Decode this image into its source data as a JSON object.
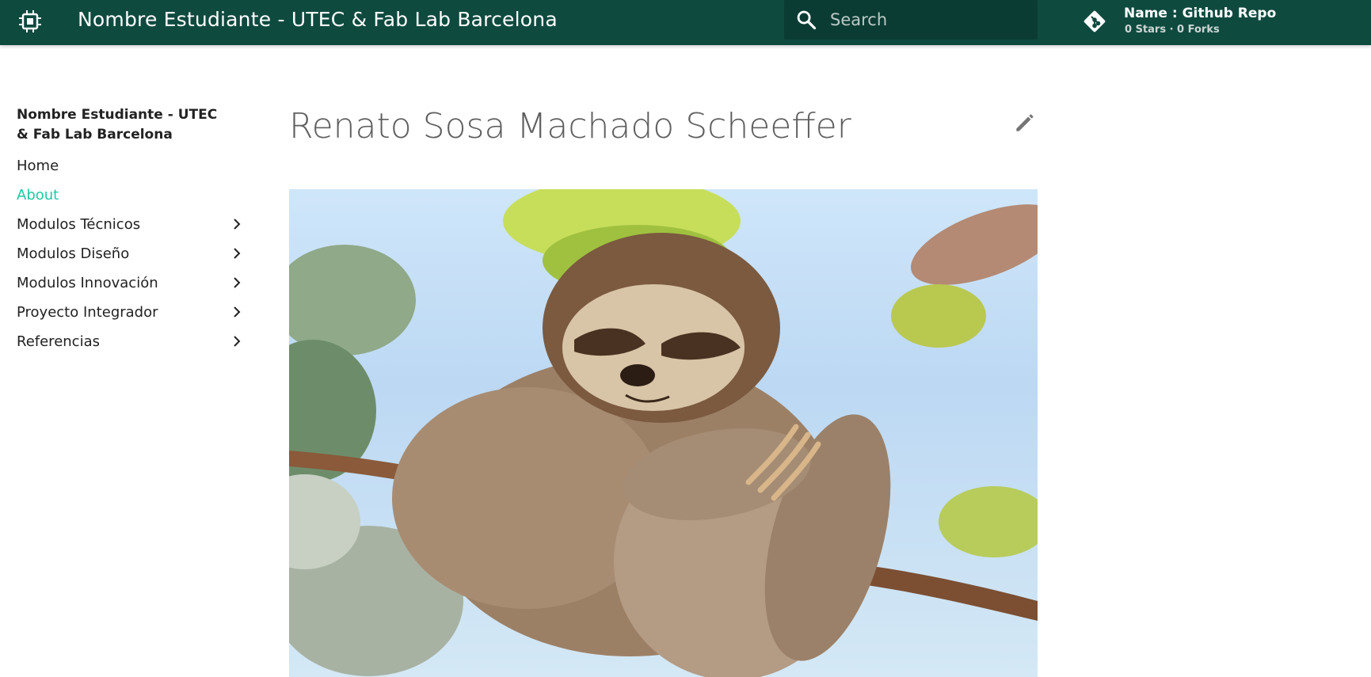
{
  "header": {
    "logo_icon": "chip-icon",
    "title": "Nombre Estudiante - UTEC & Fab Lab Barcelona",
    "background": "#0f4a3f"
  },
  "search": {
    "placeholder": "Search",
    "value": "",
    "icon": "search-icon"
  },
  "repo": {
    "icon": "git-icon",
    "name": "Name : Github Repo",
    "facts": "0 Stars · 0 Forks"
  },
  "nav": {
    "title": "Nombre Estudiante - UTEC & Fab Lab Barcelona",
    "items": [
      {
        "label": "Home",
        "expandable": false,
        "active": false
      },
      {
        "label": "About",
        "expandable": false,
        "active": true
      },
      {
        "label": "Modulos Técnicos",
        "expandable": true,
        "active": false
      },
      {
        "label": "Modulos Diseño",
        "expandable": true,
        "active": false
      },
      {
        "label": "Modulos Innovación",
        "expandable": true,
        "active": false
      },
      {
        "label": "Proyecto Integrador",
        "expandable": true,
        "active": false
      },
      {
        "label": "Referencias",
        "expandable": true,
        "active": false
      }
    ],
    "active_color": "#1fc9a4"
  },
  "content": {
    "title": "Renato Sosa Machado Scheeffer",
    "edit_icon": "pencil-icon",
    "image": "sloth-photo"
  }
}
